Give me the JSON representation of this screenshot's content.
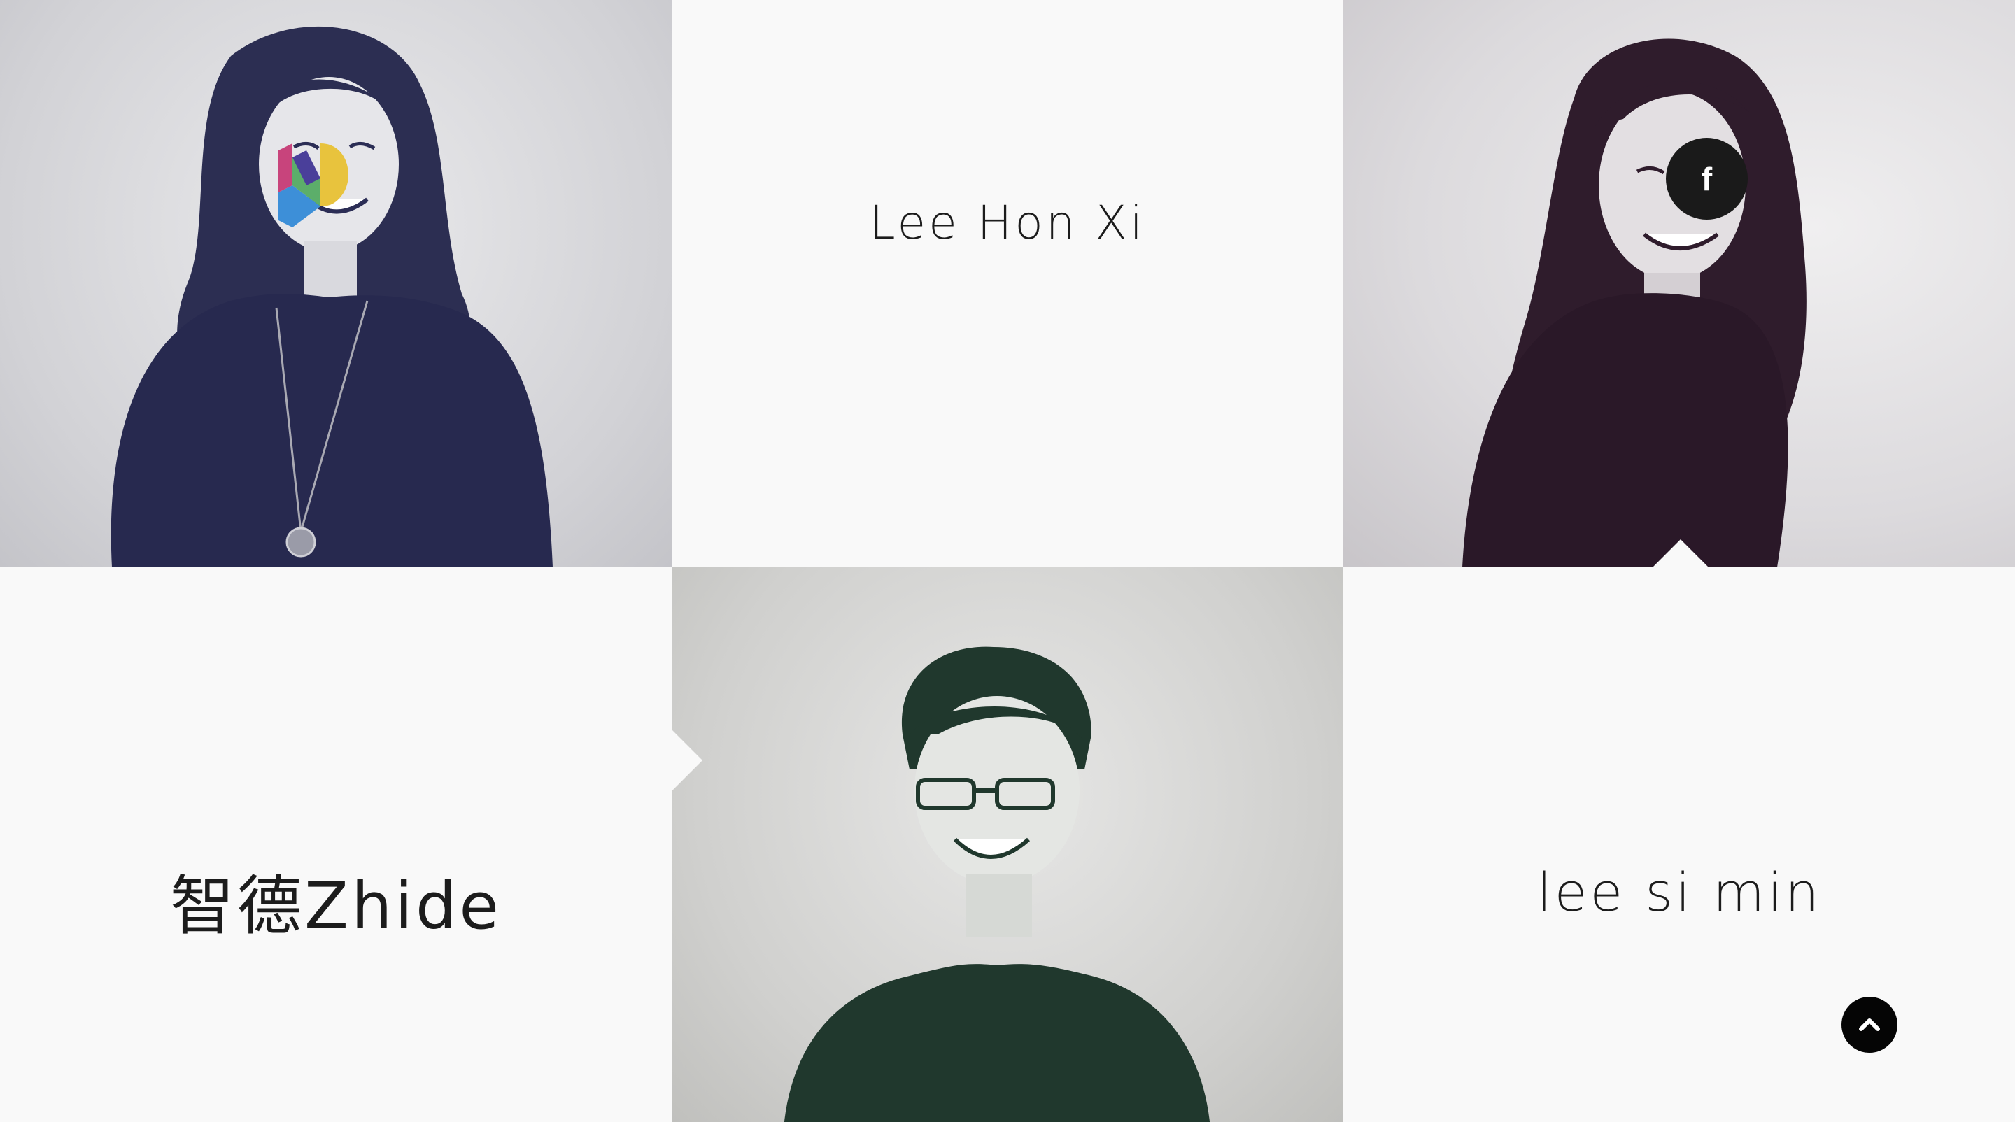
{
  "team": [
    {
      "name": "Lee Hon Xi",
      "type": "signature"
    },
    {
      "name": "智德Zhide",
      "type": "signature"
    },
    {
      "name": "lee si min",
      "type": "signature"
    }
  ],
  "social": {
    "facebook_label": "f"
  },
  "controls": {
    "scroll_top_icon": "chevron-up-icon"
  },
  "brand": {
    "logo_icon": "d-logo-icon",
    "colors": [
      "#e8c33d",
      "#3d8fd8",
      "#5cae6a",
      "#c8447c",
      "#4a3f9a"
    ]
  },
  "photo_tints": {
    "tile1": "#2b2d55",
    "tile3": "#2f1c2c",
    "tile5": "#20382d"
  }
}
